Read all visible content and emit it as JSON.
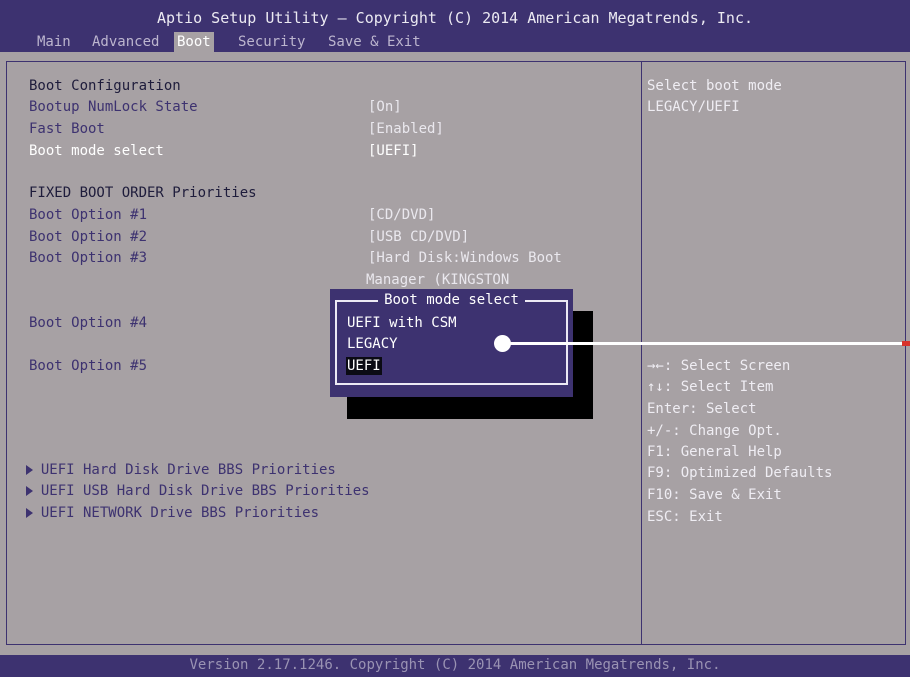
{
  "title": "Aptio Setup Utility – Copyright (C) 2014 American Megatrends, Inc.",
  "tabs": [
    "Main",
    "Advanced",
    "Boot",
    "Security",
    "Save & Exit"
  ],
  "active_tab": "Boot",
  "section1_header": "Boot Configuration",
  "settings": [
    {
      "label": "Bootup NumLock State",
      "value": "[On]"
    },
    {
      "label": "Fast Boot",
      "value": "[Enabled]"
    },
    {
      "label": "Boot mode select",
      "value": "[UEFI]"
    }
  ],
  "section2_header": "FIXED BOOT ORDER Priorities",
  "boot_options": [
    {
      "label": "Boot Option #1",
      "value": "[CD/DVD]"
    },
    {
      "label": "Boot Option #2",
      "value": "[USB CD/DVD]"
    },
    {
      "label": "Boot Option #3",
      "value": "[Hard Disk:Windows Boot",
      "value2": "Manager (KINGSTON"
    },
    {
      "label": "Boot Option #4",
      "value": ""
    },
    {
      "label": "Boot Option #5",
      "value": ""
    }
  ],
  "submenus": [
    "UEFI Hard Disk Drive BBS Priorities",
    "UEFI USB Hard Disk Drive BBS Priorities",
    "UEFI NETWORK Drive BBS Priorities"
  ],
  "help": {
    "description": [
      "Select boot mode",
      "LEGACY/UEFI"
    ],
    "keys": [
      "→←: Select Screen",
      "↑↓: Select Item",
      "Enter: Select",
      "+/-: Change Opt.",
      "F1: General Help",
      "F9: Optimized Defaults",
      "F10: Save & Exit",
      "ESC: Exit"
    ]
  },
  "popup": {
    "title": "Boot mode select",
    "options": [
      "UEFI with CSM",
      "LEGACY",
      "UEFI"
    ],
    "selected": "UEFI"
  },
  "footer": "Version 2.17.1246. Copyright (C) 2014 American Megatrends, Inc.",
  "colors": {
    "bios_blue": "#3d3270",
    "background_gray": "#a7a1a4",
    "highlight_white": "#ffffff",
    "pointer_tip_red": "#d8322c"
  }
}
